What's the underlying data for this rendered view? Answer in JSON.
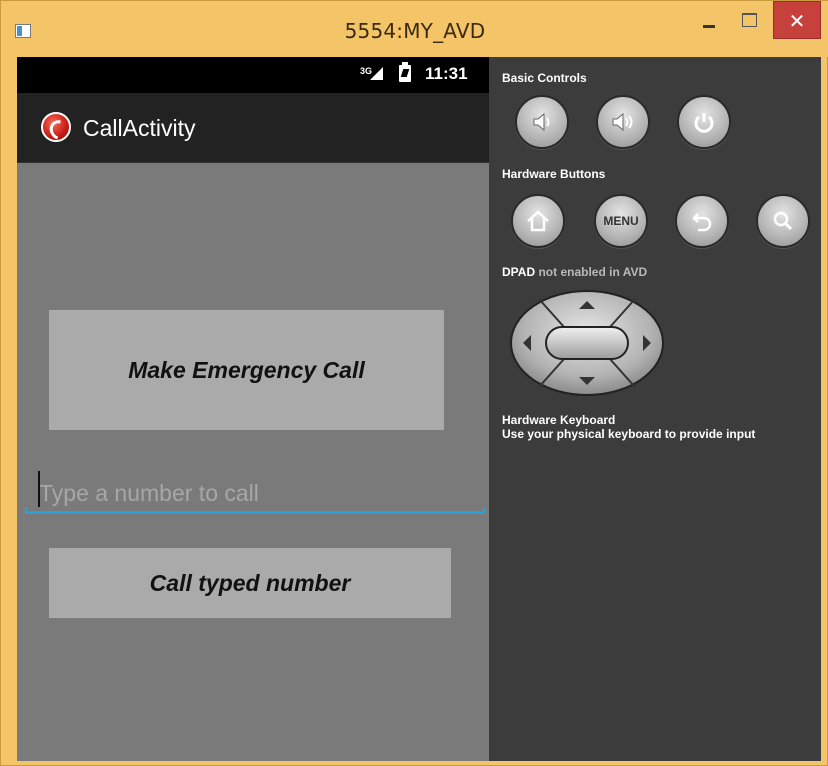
{
  "window": {
    "title": "5554:MY_AVD",
    "close_glyph": "✕"
  },
  "statusbar": {
    "network": "3G",
    "time": "11:31"
  },
  "app": {
    "title": "CallActivity",
    "emergency_button": "Make Emergency Call",
    "number_input_placeholder": "Type a number to call",
    "number_input_value": "",
    "call_button": "Call typed number"
  },
  "panel": {
    "basic_controls_label": "Basic Controls",
    "hardware_buttons_label": "Hardware Buttons",
    "menu_button": "MENU",
    "dpad_label": "DPAD",
    "dpad_status": "not enabled in AVD",
    "keyboard_label": "Hardware Keyboard",
    "keyboard_hint": "Use your physical keyboard to provide input"
  },
  "colors": {
    "window_frame": "#f4c469",
    "close_button": "#c7413c",
    "device_background": "#7a7a7a",
    "input_underline": "#2aa0d4",
    "panel_background": "#3c3c3c"
  }
}
